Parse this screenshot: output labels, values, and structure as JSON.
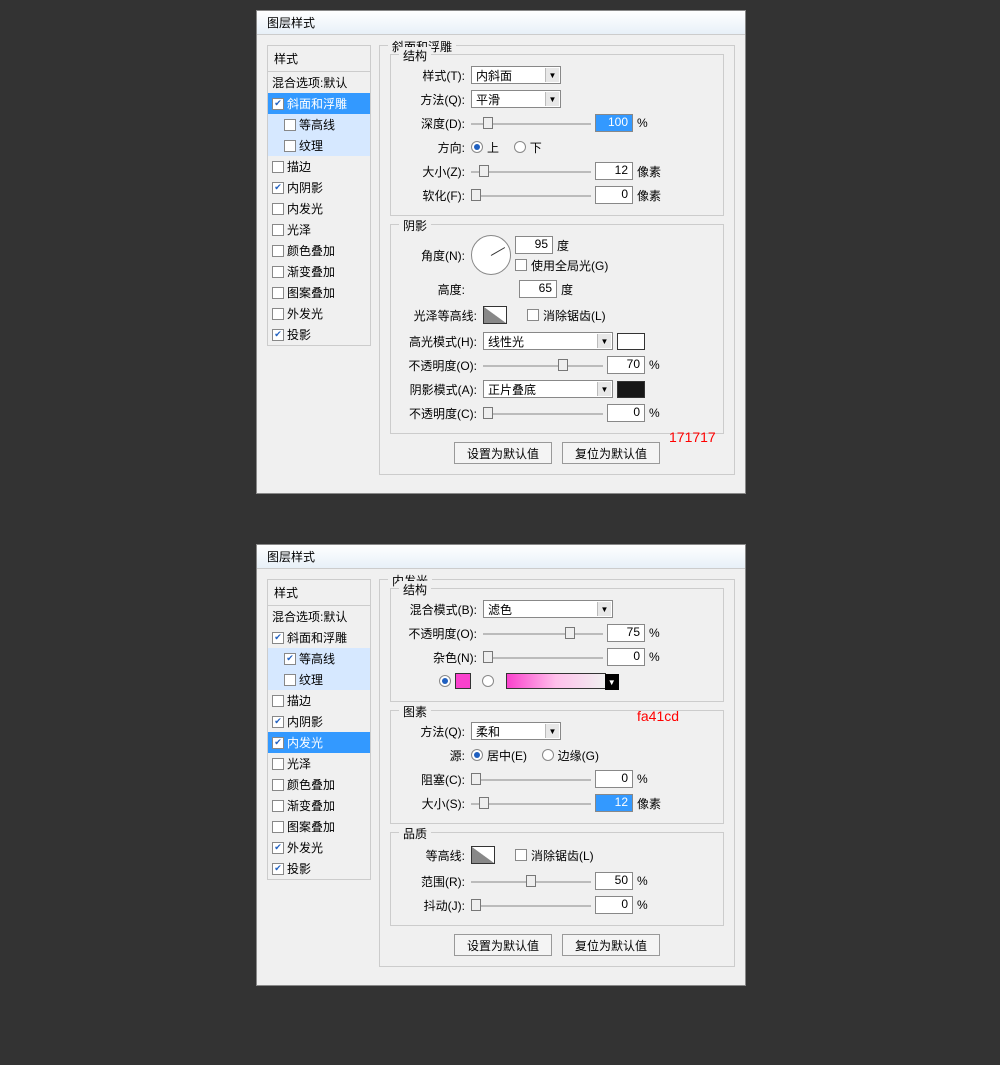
{
  "dialogs": [
    {
      "title": "图层样式",
      "leftTitle": "样式",
      "blendOptions": "混合选项:默认",
      "styleList": [
        {
          "label": "斜面和浮雕",
          "checked": true,
          "selected": true,
          "sub": false
        },
        {
          "label": "等高线",
          "checked": false,
          "selected": false,
          "sub": true
        },
        {
          "label": "纹理",
          "checked": false,
          "selected": false,
          "sub": true
        },
        {
          "label": "描边",
          "checked": false,
          "selected": false,
          "sub": false
        },
        {
          "label": "内阴影",
          "checked": true,
          "selected": false,
          "sub": false
        },
        {
          "label": "内发光",
          "checked": false,
          "selected": false,
          "sub": false
        },
        {
          "label": "光泽",
          "checked": false,
          "selected": false,
          "sub": false
        },
        {
          "label": "颜色叠加",
          "checked": false,
          "selected": false,
          "sub": false
        },
        {
          "label": "渐变叠加",
          "checked": false,
          "selected": false,
          "sub": false
        },
        {
          "label": "图案叠加",
          "checked": false,
          "selected": false,
          "sub": false
        },
        {
          "label": "外发光",
          "checked": false,
          "selected": false,
          "sub": false
        },
        {
          "label": "投影",
          "checked": true,
          "selected": false,
          "sub": false
        }
      ],
      "mainTitle": "斜面和浮雕",
      "group1Title": "结构",
      "styleLabel": "样式(T):",
      "styleValue": "内斜面",
      "methodLabel": "方法(Q):",
      "methodValue": "平滑",
      "depthLabel": "深度(D):",
      "depthValue": "100",
      "depthUnit": "%",
      "dirLabel": "方向:",
      "dirUp": "上",
      "dirDown": "下",
      "sizeLabel": "大小(Z):",
      "sizeValue": "12",
      "sizeUnit": "像素",
      "softenLabel": "软化(F):",
      "softenValue": "0",
      "softenUnit": "像素",
      "group2Title": "阴影",
      "angleLabel": "角度(N):",
      "angleValue": "95",
      "angleUnit": "度",
      "globalLight": "使用全局光(G)",
      "altitudeLabel": "高度:",
      "altitudeValue": "65",
      "altitudeUnit": "度",
      "glossLabel": "光泽等高线:",
      "antiAlias": "消除锯齿(L)",
      "hlModeLabel": "高光模式(H):",
      "hlModeValue": "线性光",
      "hlColor": "#ffffff",
      "hlOpacityLabel": "不透明度(O):",
      "hlOpacityValue": "70",
      "hlOpacityUnit": "%",
      "shModeLabel": "阴影模式(A):",
      "shModeValue": "正片叠底",
      "shColor": "#171717",
      "shOpacityLabel": "不透明度(C):",
      "shOpacityValue": "0",
      "shOpacityUnit": "%",
      "btnDefault": "设置为默认值",
      "btnReset": "复位为默认值",
      "annotation": "171717"
    },
    {
      "title": "图层样式",
      "leftTitle": "样式",
      "blendOptions": "混合选项:默认",
      "styleList": [
        {
          "label": "斜面和浮雕",
          "checked": true,
          "selected": false,
          "sub": false
        },
        {
          "label": "等高线",
          "checked": true,
          "selected": false,
          "sub": true
        },
        {
          "label": "纹理",
          "checked": false,
          "selected": false,
          "sub": true
        },
        {
          "label": "描边",
          "checked": false,
          "selected": false,
          "sub": false
        },
        {
          "label": "内阴影",
          "checked": true,
          "selected": false,
          "sub": false
        },
        {
          "label": "内发光",
          "checked": true,
          "selected": true,
          "sub": false
        },
        {
          "label": "光泽",
          "checked": false,
          "selected": false,
          "sub": false
        },
        {
          "label": "颜色叠加",
          "checked": false,
          "selected": false,
          "sub": false
        },
        {
          "label": "渐变叠加",
          "checked": false,
          "selected": false,
          "sub": false
        },
        {
          "label": "图案叠加",
          "checked": false,
          "selected": false,
          "sub": false
        },
        {
          "label": "外发光",
          "checked": true,
          "selected": false,
          "sub": false
        },
        {
          "label": "投影",
          "checked": true,
          "selected": false,
          "sub": false
        }
      ],
      "mainTitle": "内发光",
      "group1Title": "结构",
      "blendLabel": "混合模式(B):",
      "blendValue": "滤色",
      "opacityLabel": "不透明度(O):",
      "opacityValue": "75",
      "opacityUnit": "%",
      "noiseLabel": "杂色(N):",
      "noiseValue": "0",
      "noiseUnit": "%",
      "glowColor": "#fa41cd",
      "group2Title": "图素",
      "methodLabel": "方法(Q):",
      "methodValue": "柔和",
      "sourceLabel": "源:",
      "sourceCenter": "居中(E)",
      "sourceEdge": "边缘(G)",
      "chokeLabel": "阻塞(C):",
      "chokeValue": "0",
      "chokeUnit": "%",
      "sizeLabel": "大小(S):",
      "sizeValue": "12",
      "sizeUnit": "像素",
      "group3Title": "品质",
      "contourLabel": "等高线:",
      "antiAlias": "消除锯齿(L)",
      "rangeLabel": "范围(R):",
      "rangeValue": "50",
      "rangeUnit": "%",
      "jitterLabel": "抖动(J):",
      "jitterValue": "0",
      "jitterUnit": "%",
      "btnDefault": "设置为默认值",
      "btnReset": "复位为默认值",
      "annotation": "fa41cd"
    }
  ]
}
